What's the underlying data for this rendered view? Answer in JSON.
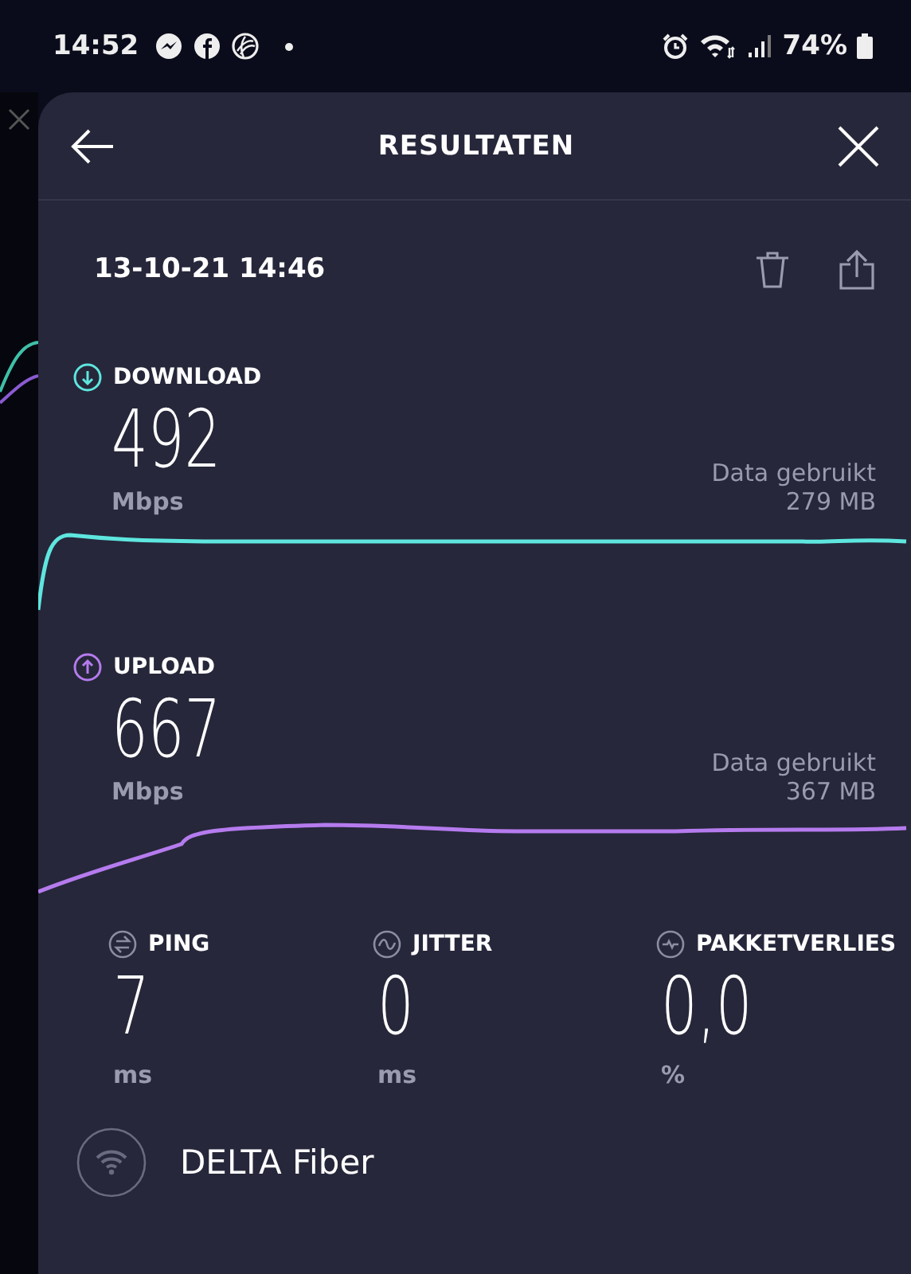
{
  "status_bar": {
    "time": "14:52",
    "battery": "74%"
  },
  "header": {
    "title": "RESULTATEN"
  },
  "date": "13-10-21 14:46",
  "results": [
    {
      "label": "DOWNLOAD",
      "kind": "download",
      "color": "#5ee6df",
      "value": "492",
      "unit": "Mbps",
      "data_label": "Data gebruikt",
      "data_value": "279 MB"
    },
    {
      "label": "UPLOAD",
      "kind": "upload",
      "color": "#b57bee",
      "value": "667",
      "unit": "Mbps",
      "data_label": "Data gebruikt",
      "data_value": "367 MB"
    }
  ],
  "metrics": [
    {
      "kind": "ping",
      "label": "PING",
      "value": "7",
      "unit": "ms"
    },
    {
      "kind": "jitter",
      "label": "JITTER",
      "value": "0",
      "unit": "ms"
    },
    {
      "kind": "loss",
      "label": "PAKKETVERLIES",
      "value": "0,0",
      "unit": "%"
    }
  ],
  "network": {
    "name": "DELTA Fiber"
  }
}
